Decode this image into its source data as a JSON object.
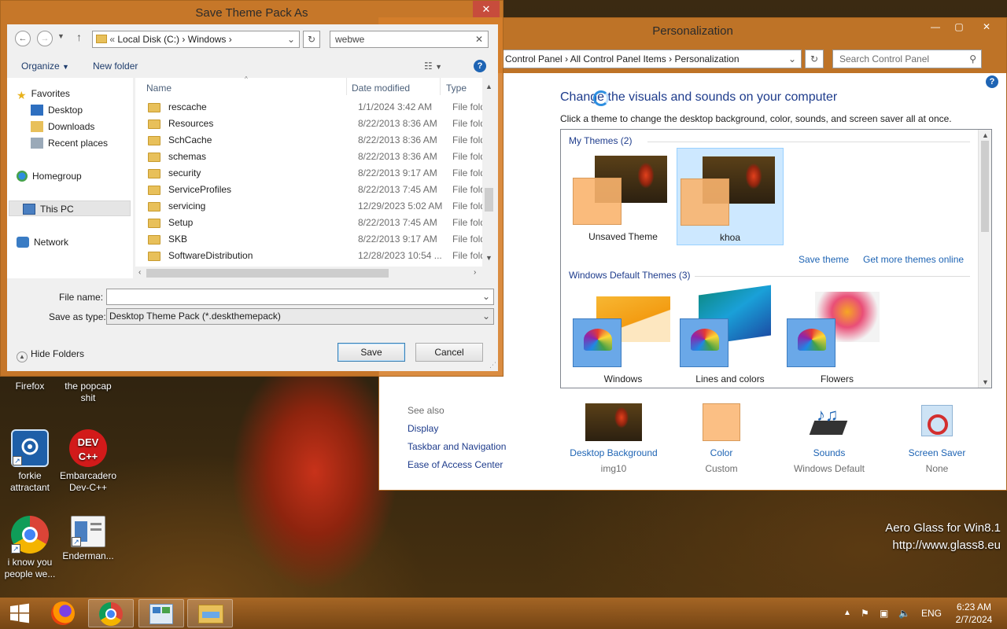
{
  "desktop": {
    "icons": [
      {
        "label": "Firefox",
        "icon": "firefox-icon"
      },
      {
        "label": "the popcap shit",
        "icon": "folder-shortcut-icon"
      },
      {
        "label": "forkie attractant",
        "icon": "settings-screen-icon"
      },
      {
        "label": "Embarcadero Dev-C++",
        "icon": "devcpp-icon"
      },
      {
        "label": "i know you people we...",
        "icon": "chrome-icon"
      },
      {
        "label": "Enderman...",
        "icon": "document-window-icon"
      }
    ],
    "watermark_line1": "Aero Glass for Win8.1",
    "watermark_line2": "http://www.glass8.eu"
  },
  "personalization": {
    "title": "Personalization",
    "address": {
      "crumb1": "Control Panel",
      "crumb2": "All Control Panel Items",
      "crumb3": "Personalization"
    },
    "search_placeholder": "Search Control Panel",
    "heading": "Change the visuals and sounds on your computer",
    "subheading": "Click a theme to change the desktop background, color, sounds, and screen saver all at once.",
    "my_themes_label": "My Themes (2)",
    "my_themes": [
      {
        "label": "Unsaved Theme",
        "selected": false
      },
      {
        "label": "khoa",
        "selected": true
      }
    ],
    "save_theme_link": "Save theme",
    "get_more_link": "Get more themes online",
    "default_themes_label": "Windows Default Themes (3)",
    "default_themes": [
      {
        "label": "Windows"
      },
      {
        "label": "Lines and colors"
      },
      {
        "label": "Flowers"
      }
    ],
    "see_also": {
      "title": "See also",
      "links": [
        "Display",
        "Taskbar and Navigation",
        "Ease of Access Center"
      ]
    },
    "bottom_items": [
      {
        "label": "Desktop Background",
        "value": "img10"
      },
      {
        "label": "Color",
        "value": "Custom"
      },
      {
        "label": "Sounds",
        "value": "Windows Default"
      },
      {
        "label": "Screen Saver",
        "value": "None"
      }
    ]
  },
  "dialog": {
    "title": "Save Theme Pack As",
    "address": {
      "prefix": "«",
      "crumb1": "Local Disk (C:)",
      "crumb2": "Windows"
    },
    "search_value": "webwe",
    "organize": "Organize",
    "new_folder": "New folder",
    "nav": {
      "favorites": "Favorites",
      "desktop": "Desktop",
      "downloads": "Downloads",
      "recent": "Recent places",
      "homegroup": "Homegroup",
      "this_pc": "This PC",
      "network": "Network"
    },
    "columns": {
      "name": "Name",
      "date": "Date modified",
      "type": "Type"
    },
    "files": [
      {
        "name": "rescache",
        "date": "1/1/2024 3:42 AM",
        "type": "File folde"
      },
      {
        "name": "Resources",
        "date": "8/22/2013 8:36 AM",
        "type": "File folde"
      },
      {
        "name": "SchCache",
        "date": "8/22/2013 8:36 AM",
        "type": "File folde"
      },
      {
        "name": "schemas",
        "date": "8/22/2013 8:36 AM",
        "type": "File folde"
      },
      {
        "name": "security",
        "date": "8/22/2013 9:17 AM",
        "type": "File folde"
      },
      {
        "name": "ServiceProfiles",
        "date": "8/22/2013 7:45 AM",
        "type": "File folde"
      },
      {
        "name": "servicing",
        "date": "12/29/2023 5:02 AM",
        "type": "File folde"
      },
      {
        "name": "Setup",
        "date": "8/22/2013 7:45 AM",
        "type": "File folde"
      },
      {
        "name": "SKB",
        "date": "8/22/2013 9:17 AM",
        "type": "File folde"
      },
      {
        "name": "SoftwareDistribution",
        "date": "12/28/2023 10:54 ...",
        "type": "File folde"
      }
    ],
    "file_name_label": "File name:",
    "file_name_value": "",
    "save_as_type_label": "Save as type:",
    "save_as_type_value": "Desktop Theme Pack (*.deskthemepack)",
    "hide_folders": "Hide Folders",
    "save": "Save",
    "cancel": "Cancel"
  },
  "taskbar": {
    "apps": [
      "start-icon",
      "firefox-icon",
      "chrome-icon",
      "control-panel-icon",
      "file-explorer-icon"
    ],
    "lang": "ENG",
    "time": "6:23 AM",
    "date": "2/7/2024"
  },
  "colors": {
    "accent_link": "#1e64b4",
    "heading": "#1e3c8c",
    "window_glass": "#d6802c"
  }
}
